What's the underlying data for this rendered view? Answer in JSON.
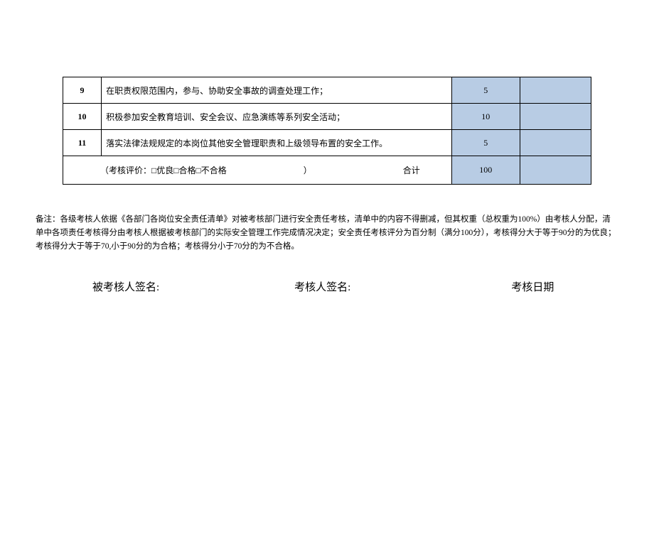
{
  "table": {
    "rows": [
      {
        "num": "9",
        "desc": "在职责权限范围内，参与、协助安全事故的调查处理工作；",
        "score": "5"
      },
      {
        "num": "10",
        "desc": "积极参加安全教育培训、安全会议、应急演练等系列安全活动；",
        "score": "10"
      },
      {
        "num": "11",
        "desc": "落实法律法规规定的本岗位其他安全管理职责和上级领导布置的安全工作。",
        "score": "5"
      }
    ],
    "eval_label": "（考核评价：□优良□合格□不合格",
    "eval_close": "）",
    "total_label": "合计",
    "total_score": "100"
  },
  "notes": "备注：各级考核人依据《各部门各岗位安全责任清单》对被考核部门进行安全责任考核，清单中的内容不得删减，但其权重（总权重为100%）由考核人分配，清单中各项责任考核得分由考核人根据被考核部门的实际安全管理工作完成情况决定；安全责任考核评分为百分制（满分100分），考核得分大于等于90分的为优良；考核得分大于等于70,小于90分的为合格；考核得分小于70分的为不合格。",
  "signatures": {
    "assessee": "被考核人签名:",
    "assessor": "考核人签名:",
    "date": "考核日期"
  }
}
